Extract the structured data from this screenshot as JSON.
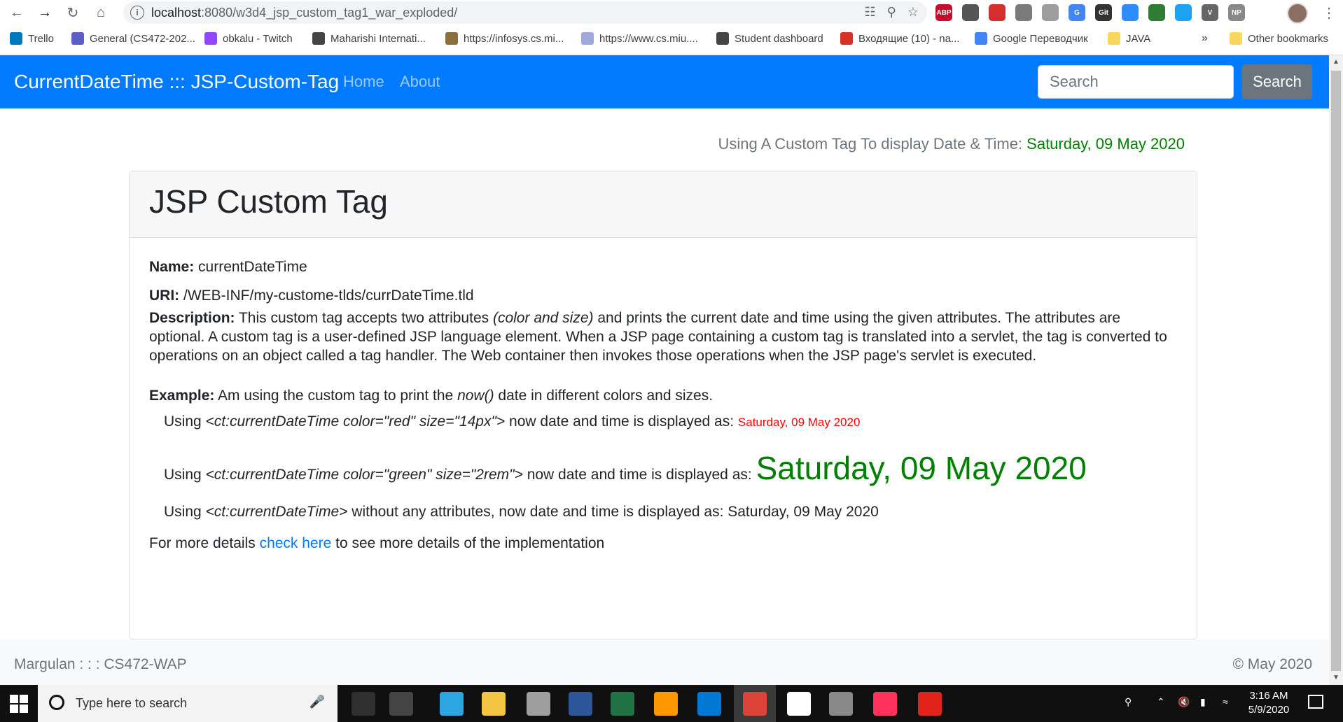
{
  "browser": {
    "url_host": "localhost",
    "url_path": ":8080/w3d4_jsp_custom_tag1_war_exploded/",
    "bookmarks": [
      {
        "label": "Trello",
        "color": "#0079bf"
      },
      {
        "label": "General (CS472-202...",
        "color": "#5b5fc7"
      },
      {
        "label": "obkalu - Twitch",
        "color": "#9146ff"
      },
      {
        "label": "Maharishi Internati...",
        "color": "#444444"
      },
      {
        "label": "https://infosys.cs.mi...",
        "color": "#8d6e3f"
      },
      {
        "label": "https://www.cs.miu....",
        "color": "#9fa8da"
      },
      {
        "label": "Student dashboard",
        "color": "#444444"
      },
      {
        "label": "Входящие (10) - na...",
        "color": "#d93025"
      },
      {
        "label": "Google Переводчик",
        "color": "#4285f4"
      },
      {
        "label": "JAVA",
        "color": "#f9d65c"
      }
    ],
    "bookmarks_more": "»",
    "other_bookmarks": "Other bookmarks",
    "extensions": [
      {
        "label": "ABP",
        "color": "#c70d2c"
      },
      {
        "label": "",
        "color": "#555555"
      },
      {
        "label": "",
        "color": "#d32f2f"
      },
      {
        "label": "",
        "color": "#7a7a7a"
      },
      {
        "label": "",
        "color": "#9e9e9e"
      },
      {
        "label": "G",
        "color": "#4285f4"
      },
      {
        "label": "Git",
        "color": "#333333"
      },
      {
        "label": "",
        "color": "#2d8cff"
      },
      {
        "label": "",
        "color": "#2e7d32"
      },
      {
        "label": "",
        "color": "#1da1f2"
      },
      {
        "label": "V",
        "color": "#666666"
      },
      {
        "label": "NP",
        "color": "#888888"
      }
    ]
  },
  "navbar": {
    "brand": "CurrentDateTime ::: JSP-Custom-Tag",
    "links": [
      "Home",
      "About"
    ],
    "search_placeholder": "Search",
    "search_button": "Search"
  },
  "date_line": {
    "prefix": "Using A Custom Tag To display Date & Time: ",
    "date": "Saturday, 09 May 2020"
  },
  "card": {
    "title": "JSP Custom Tag",
    "name_label": "Name:",
    "name_value": " currentDateTime",
    "uri_label": "URI:",
    "uri_value": " /WEB-INF/my-custome-tlds/currDateTime.tld",
    "desc_label": "Description:",
    "desc_part1": " This custom tag accepts two attributes ",
    "desc_italic": "(color and size)",
    "desc_part2": " and prints the current date and time using the given attributes. The attributes are optional. A custom tag is a user-defined JSP language element. When a JSP page containing a custom tag is translated into a servlet, the tag is converted to operations on an object called a tag handler. The Web container then invokes those operations when the JSP page's servlet is executed.",
    "example_label": "Example:",
    "example_part1": " Am using the custom tag to print the ",
    "example_italic": "now()",
    "example_part2": " date in different colors and sizes.",
    "ex1_prefix": "Using ",
    "ex1_tag": "<ct:currentDateTime color=\"red\" size=\"14px\">",
    "ex1_suffix": " now date and time is displayed as: ",
    "ex1_date": "Saturday, 09 May 2020",
    "ex2_prefix": "Using ",
    "ex2_tag": "<ct:currentDateTime color=\"green\" size=\"2rem\">",
    "ex2_suffix": " now date and time is displayed as: ",
    "ex2_date": "Saturday, 09 May 2020",
    "ex3_prefix": "Using ",
    "ex3_tag": "<ct:currentDateTime>",
    "ex3_suffix": " without any attributes, now date and time is displayed as: Saturday, 09 May 2020",
    "more_prefix": "For more details ",
    "more_link": "check here",
    "more_suffix": " to see more details of the implementation"
  },
  "footer": {
    "left": "Margulan : : : CS472-WAP",
    "right": "© May 2020"
  },
  "taskbar": {
    "search_placeholder": "Type here to search",
    "time": "3:16 AM",
    "date": "5/9/2020",
    "apps": [
      {
        "name": "task-view",
        "color": "#303030"
      },
      {
        "name": "calculator",
        "color": "#444444"
      },
      {
        "name": "telegram",
        "color": "#2ca5e0"
      },
      {
        "name": "file-explorer",
        "color": "#f4c542"
      },
      {
        "name": "paint",
        "color": "#9e9e9e"
      },
      {
        "name": "word",
        "color": "#2b579a"
      },
      {
        "name": "excel",
        "color": "#217346"
      },
      {
        "name": "sublime",
        "color": "#ff9800"
      },
      {
        "name": "outlook",
        "color": "#0078d4"
      },
      {
        "name": "chrome",
        "color": "#db4437"
      },
      {
        "name": "notes",
        "color": "#ffffff"
      },
      {
        "name": "settings",
        "color": "#888888"
      },
      {
        "name": "intellij",
        "color": "#fe315d"
      },
      {
        "name": "acrobat",
        "color": "#e2231a"
      }
    ]
  }
}
